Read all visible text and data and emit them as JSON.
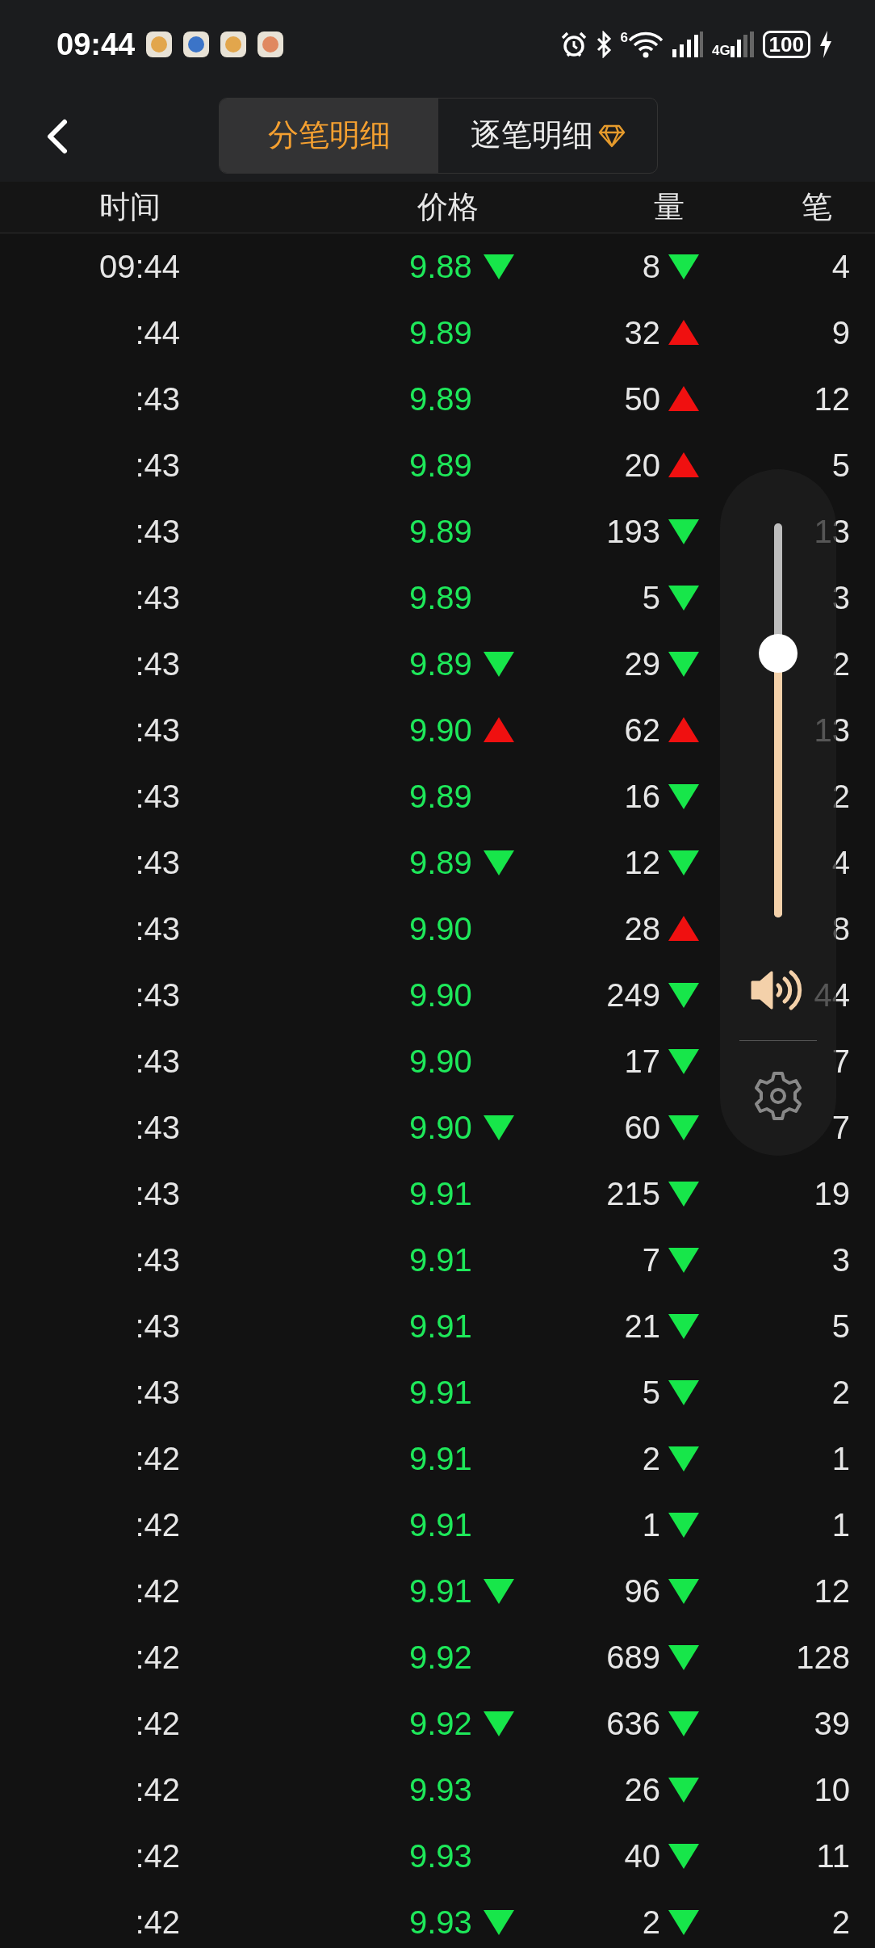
{
  "status_bar": {
    "time": "09:44",
    "wifi_label": "6",
    "network": "4G",
    "battery": "100"
  },
  "tabs": [
    {
      "label": "分笔明细",
      "selected": true,
      "premium": false
    },
    {
      "label": "逐笔明细",
      "selected": false,
      "premium": true
    }
  ],
  "table": {
    "columns": [
      "时间",
      "价格",
      "量",
      "笔"
    ],
    "rows": [
      {
        "time": "09:44",
        "price": "9.88",
        "price_up": false,
        "volume": "8",
        "volume_up": false,
        "count": "4"
      },
      {
        "time": ":44",
        "price": "9.89",
        "volume": "32",
        "volume_up": true,
        "count": "9"
      },
      {
        "time": ":43",
        "price": "9.89",
        "volume": "50",
        "volume_up": true,
        "count": "12"
      },
      {
        "time": ":43",
        "price": "9.89",
        "volume": "20",
        "volume_up": true,
        "count": "5"
      },
      {
        "time": ":43",
        "price": "9.89",
        "volume": "193",
        "volume_up": false,
        "count": "13"
      },
      {
        "time": ":43",
        "price": "9.89",
        "volume": "5",
        "volume_up": false,
        "count": "3"
      },
      {
        "time": ":43",
        "price": "9.89",
        "price_up": false,
        "volume": "29",
        "volume_up": false,
        "count": "2"
      },
      {
        "time": ":43",
        "price": "9.90",
        "price_up": true,
        "volume": "62",
        "volume_up": true,
        "count": "13"
      },
      {
        "time": ":43",
        "price": "9.89",
        "volume": "16",
        "volume_up": false,
        "count": "2"
      },
      {
        "time": ":43",
        "price": "9.89",
        "price_up": false,
        "volume": "12",
        "volume_up": false,
        "count": "4"
      },
      {
        "time": ":43",
        "price": "9.90",
        "volume": "28",
        "volume_up": true,
        "count": "8"
      },
      {
        "time": ":43",
        "price": "9.90",
        "volume": "249",
        "volume_up": false,
        "count": "44"
      },
      {
        "time": ":43",
        "price": "9.90",
        "volume": "17",
        "volume_up": false,
        "count": "7"
      },
      {
        "time": ":43",
        "price": "9.90",
        "price_up": false,
        "volume": "60",
        "volume_up": false,
        "count": "7"
      },
      {
        "time": ":43",
        "price": "9.91",
        "volume": "215",
        "volume_up": false,
        "count": "19"
      },
      {
        "time": ":43",
        "price": "9.91",
        "volume": "7",
        "volume_up": false,
        "count": "3"
      },
      {
        "time": ":43",
        "price": "9.91",
        "volume": "21",
        "volume_up": false,
        "count": "5"
      },
      {
        "time": ":43",
        "price": "9.91",
        "volume": "5",
        "volume_up": false,
        "count": "2"
      },
      {
        "time": ":42",
        "price": "9.91",
        "volume": "2",
        "volume_up": false,
        "count": "1"
      },
      {
        "time": ":42",
        "price": "9.91",
        "volume": "1",
        "volume_up": false,
        "count": "1"
      },
      {
        "time": ":42",
        "price": "9.91",
        "price_up": false,
        "volume": "96",
        "volume_up": false,
        "count": "12"
      },
      {
        "time": ":42",
        "price": "9.92",
        "volume": "689",
        "volume_up": false,
        "count": "128"
      },
      {
        "time": ":42",
        "price": "9.92",
        "price_up": false,
        "volume": "636",
        "volume_up": false,
        "count": "39"
      },
      {
        "time": ":42",
        "price": "9.93",
        "volume": "26",
        "volume_up": false,
        "count": "10"
      },
      {
        "time": ":42",
        "price": "9.93",
        "volume": "40",
        "volume_up": false,
        "count": "11"
      },
      {
        "time": ":42",
        "price": "9.93",
        "price_up": false,
        "volume": "2",
        "volume_up": false,
        "count": "2"
      }
    ]
  },
  "volume_panel": {
    "level": 0.67
  }
}
